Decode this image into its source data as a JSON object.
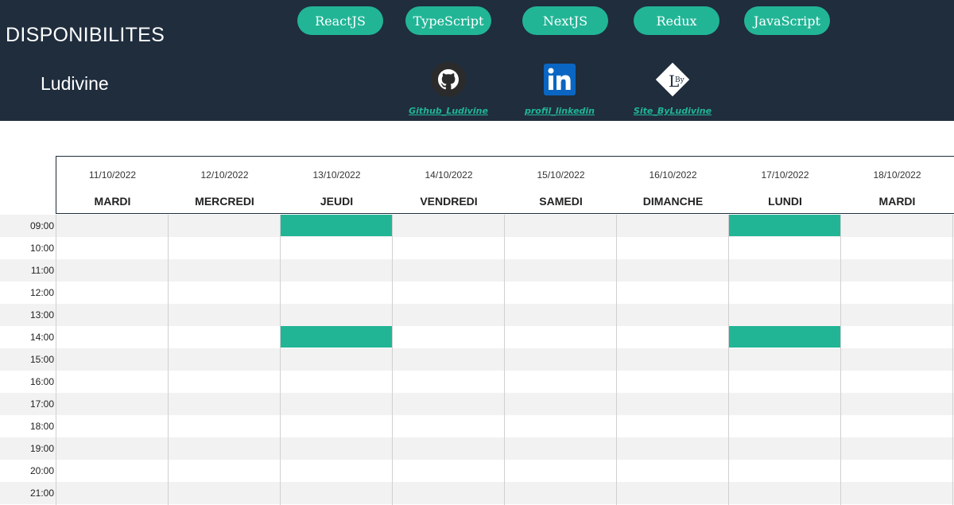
{
  "header": {
    "title": "DISPONIBILITES",
    "user": "Ludivine",
    "skills": [
      "ReactJS",
      "TypeScript",
      "NextJS",
      "Redux",
      "JavaScript"
    ],
    "links": [
      {
        "label": "Github_Ludivine",
        "icon": "github-icon"
      },
      {
        "label": "profil_linkedin",
        "icon": "linkedin-icon"
      },
      {
        "label": "Site_ByLudivine",
        "icon": "byludivine-logo-icon"
      }
    ]
  },
  "calendar": {
    "days": [
      {
        "date": "11/10/2022",
        "name": "MARDI"
      },
      {
        "date": "12/10/2022",
        "name": "MERCREDI"
      },
      {
        "date": "13/10/2022",
        "name": "JEUDI"
      },
      {
        "date": "14/10/2022",
        "name": "VENDREDI"
      },
      {
        "date": "15/10/2022",
        "name": "SAMEDI"
      },
      {
        "date": "16/10/2022",
        "name": "DIMANCHE"
      },
      {
        "date": "17/10/2022",
        "name": "LUNDI"
      },
      {
        "date": "18/10/2022",
        "name": "MARDI"
      }
    ],
    "hours": [
      "09:00",
      "10:00",
      "11:00",
      "12:00",
      "13:00",
      "14:00",
      "15:00",
      "16:00",
      "17:00",
      "18:00",
      "19:00",
      "20:00",
      "21:00"
    ],
    "available_slots": [
      {
        "day": "13/10/2022",
        "hour": "09:00"
      },
      {
        "day": "17/10/2022",
        "hour": "09:00"
      },
      {
        "day": "13/10/2022",
        "hour": "14:00"
      },
      {
        "day": "17/10/2022",
        "hour": "14:00"
      }
    ]
  },
  "colors": {
    "header_bg": "#1f2d3d",
    "accent": "#21b596",
    "row_alt": "#f2f2f2"
  }
}
